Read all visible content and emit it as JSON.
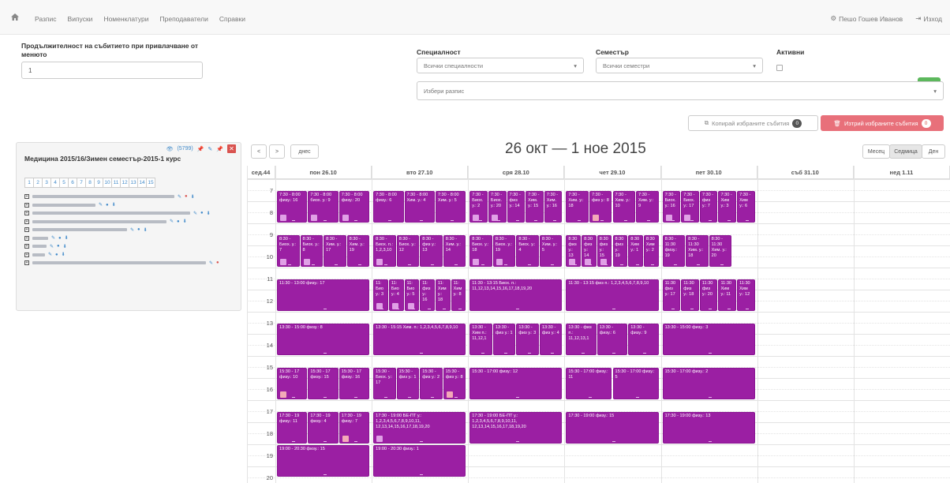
{
  "nav": {
    "items": [
      "Разпис",
      "Випуски",
      "Номенклатури",
      "Преподаватели",
      "Справки"
    ],
    "user": "Пешо Гошев Иванов",
    "logout": "Изход"
  },
  "form": {
    "duration_label": "Продължителност на събитието при привлачване от менюто",
    "duration_value": "1",
    "specialty_label": "Специалност",
    "specialty_value": "Всички специалности",
    "semester_label": "Семестър",
    "semester_value": "Всички семестри",
    "active_label": "Активни",
    "schedule_placeholder": "Избери разпис"
  },
  "actions": {
    "copy_label": "Копирай избраните събития",
    "copy_count": "0",
    "delete_label": "Изтрий избраните събития",
    "delete_count": "0"
  },
  "panel": {
    "title": "Медицина 2015/16/Зимен семестър-2015-1 курс",
    "count_link": "(5799)",
    "pages": [
      "1",
      "2",
      "3",
      "4",
      "5",
      "6",
      "7",
      "8",
      "9",
      "10",
      "11",
      "12",
      "13",
      "14",
      "15"
    ],
    "rows": [
      {
        "w": 180,
        "icons": [
          "pencil",
          "minus-red",
          "pin"
        ]
      },
      {
        "w": 80,
        "icons": [
          "pencil",
          "eye",
          "pin"
        ]
      },
      {
        "w": 200,
        "icons": [
          "pencil",
          "eye",
          "pin"
        ]
      },
      {
        "w": 170,
        "icons": [
          "pencil",
          "eye",
          "pin"
        ]
      },
      {
        "w": 120,
        "icons": [
          "pencil",
          "eye",
          "pin"
        ]
      },
      {
        "w": 20,
        "icons": [
          "pencil",
          "eye",
          "pin"
        ]
      },
      {
        "w": 18,
        "icons": [
          "pencil",
          "eye",
          "pin"
        ]
      },
      {
        "w": 16,
        "icons": [
          "pencil",
          "eye",
          "pin"
        ]
      },
      {
        "w": 220,
        "icons": [
          "pencil",
          "minus-red"
        ]
      }
    ]
  },
  "calendar": {
    "prev": "<",
    "next": ">",
    "today": "днес",
    "title": "26 окт — 1 ное 2015",
    "views": [
      "Месец",
      "Седмица",
      "Ден"
    ],
    "active_view": "Седмица",
    "week_label": "сед.44",
    "days": [
      "пон 26.10",
      "вто 27.10",
      "сря 28.10",
      "чет 29.10",
      "пет 30.10",
      "съб 31.10",
      "нед 1.11"
    ],
    "hours": [
      "7",
      "8",
      "9",
      "10",
      "11",
      "12",
      "13",
      "14",
      "15",
      "16",
      "17",
      "18",
      "19",
      "20"
    ],
    "events": [
      {
        "day": 0,
        "start": 7.5,
        "end": 9,
        "col": 0,
        "cols": 3,
        "text": "7:30 - 8:00 физу.: 16",
        "icon": "magnifier"
      },
      {
        "day": 0,
        "start": 7.5,
        "end": 9,
        "col": 1,
        "cols": 3,
        "text": "7:30 - 8:00 биох. у.: 9",
        "icon": "magnifier"
      },
      {
        "day": 0,
        "start": 7.5,
        "end": 9,
        "col": 2,
        "cols": 3,
        "text": "7:30 - 8:00 физу.: 20",
        "icon": "magnifier"
      },
      {
        "day": 1,
        "start": 7.5,
        "end": 9,
        "col": 0,
        "cols": 3,
        "text": "7:30 - 8:00 физу.: 6",
        "icon": ""
      },
      {
        "day": 1,
        "start": 7.5,
        "end": 9,
        "col": 1,
        "cols": 3,
        "text": "7:30 - 8:00 Хим. у.: 4",
        "icon": ""
      },
      {
        "day": 1,
        "start": 7.5,
        "end": 9,
        "col": 2,
        "cols": 3,
        "text": "7:30 - 8:00 Хим. у.: 5",
        "icon": ""
      },
      {
        "day": 2,
        "start": 7.5,
        "end": 9,
        "col": 0,
        "cols": 5,
        "text": "7:30 - Биох. у.: 2",
        "icon": "magnifier"
      },
      {
        "day": 2,
        "start": 7.5,
        "end": 9,
        "col": 1,
        "cols": 5,
        "text": "7:30 - Биох. у.: 20",
        "icon": "magnifier"
      },
      {
        "day": 2,
        "start": 7.5,
        "end": 9,
        "col": 2,
        "cols": 5,
        "text": "7:30 - физ у.: 14",
        "icon": ""
      },
      {
        "day": 2,
        "start": 7.5,
        "end": 9,
        "col": 3,
        "cols": 5,
        "text": "7:30 - Хим. у.: 15",
        "icon": ""
      },
      {
        "day": 2,
        "start": 7.5,
        "end": 9,
        "col": 4,
        "cols": 5,
        "text": "7:30 - Хим. у.: 16",
        "icon": ""
      },
      {
        "day": 3,
        "start": 7.5,
        "end": 9,
        "col": 0,
        "cols": 4,
        "text": "7:30 - Хим. у.: 18",
        "icon": ""
      },
      {
        "day": 3,
        "start": 7.5,
        "end": 9,
        "col": 1,
        "cols": 4,
        "text": "7:30 - физ у.: 8",
        "icon": "red"
      },
      {
        "day": 3,
        "start": 7.5,
        "end": 9,
        "col": 2,
        "cols": 4,
        "text": "7:30 - Хим. у.: 10",
        "icon": ""
      },
      {
        "day": 3,
        "start": 7.5,
        "end": 9,
        "col": 3,
        "cols": 4,
        "text": "7:30 - Хим. у.: 9",
        "icon": ""
      },
      {
        "day": 4,
        "start": 7.5,
        "end": 9,
        "col": 0,
        "cols": 5,
        "text": "7:30 - Биох. у.: 16",
        "icon": "magnifier"
      },
      {
        "day": 4,
        "start": 7.5,
        "end": 9,
        "col": 1,
        "cols": 5,
        "text": "7:30 - Биох. у.: 17",
        "icon": "magnifier"
      },
      {
        "day": 4,
        "start": 7.5,
        "end": 9,
        "col": 2,
        "cols": 5,
        "text": "7:30 - физ у.: 7",
        "icon": ""
      },
      {
        "day": 4,
        "start": 7.5,
        "end": 9,
        "col": 3,
        "cols": 5,
        "text": "7:30 - Хим у.: 3",
        "icon": ""
      },
      {
        "day": 4,
        "start": 7.5,
        "end": 9,
        "col": 4,
        "cols": 5,
        "text": "7:30 - Хим у.: 6",
        "icon": ""
      },
      {
        "day": 0,
        "start": 9.5,
        "end": 11,
        "col": 0,
        "cols": 4,
        "text": "8:30 - Биох. у.: 7",
        "icon": "magnifier"
      },
      {
        "day": 0,
        "start": 9.5,
        "end": 11,
        "col": 1,
        "cols": 4,
        "text": "8:30 - Биох. у.: 8",
        "icon": "magnifier"
      },
      {
        "day": 0,
        "start": 9.5,
        "end": 11,
        "col": 2,
        "cols": 4,
        "text": "8:30 - Хим. у.: 17",
        "icon": ""
      },
      {
        "day": 0,
        "start": 9.5,
        "end": 11,
        "col": 3,
        "cols": 4,
        "text": "8:30 - Хим. у.: 19",
        "icon": ""
      },
      {
        "day": 1,
        "start": 9.5,
        "end": 11,
        "col": 0,
        "cols": 4,
        "text": "8:30 - Биох. п.: 1,2,3,10",
        "icon": "magnifier"
      },
      {
        "day": 1,
        "start": 9.5,
        "end": 11,
        "col": 1,
        "cols": 4,
        "text": "8:30 - Биох. у.: 12",
        "icon": ""
      },
      {
        "day": 1,
        "start": 9.5,
        "end": 11,
        "col": 2,
        "cols": 4,
        "text": "8:30 - физ у.: 13",
        "icon": ""
      },
      {
        "day": 1,
        "start": 9.5,
        "end": 11,
        "col": 3,
        "cols": 4,
        "text": "8:30 - Хим. у.: 14",
        "icon": ""
      },
      {
        "day": 2,
        "start": 9.5,
        "end": 11,
        "col": 0,
        "cols": 4,
        "text": "8:30 - Биох. у.: 18",
        "icon": "magnifier"
      },
      {
        "day": 2,
        "start": 9.5,
        "end": 11,
        "col": 1,
        "cols": 4,
        "text": "8:30 - Биох. у.: 19",
        "icon": "magnifier"
      },
      {
        "day": 2,
        "start": 9.5,
        "end": 11,
        "col": 2,
        "cols": 4,
        "text": "8:30 - Биох. у.: 4",
        "icon": ""
      },
      {
        "day": 2,
        "start": 9.5,
        "end": 11,
        "col": 3,
        "cols": 4,
        "text": "8:30 - Хим. у.: 5",
        "icon": ""
      },
      {
        "day": 3,
        "start": 9.5,
        "end": 11,
        "col": 0,
        "cols": 6,
        "text": "8:30 физ у.: 13",
        "icon": "magnifier"
      },
      {
        "day": 3,
        "start": 9.5,
        "end": 11,
        "col": 1,
        "cols": 6,
        "text": "8:30 физ у.: 14",
        "icon": "magnifier"
      },
      {
        "day": 3,
        "start": 9.5,
        "end": 11,
        "col": 2,
        "cols": 6,
        "text": "8:30 физ у.: 15",
        "icon": "magnifier"
      },
      {
        "day": 3,
        "start": 9.5,
        "end": 11,
        "col": 3,
        "cols": 6,
        "text": "8:30 физ у.: 19",
        "icon": ""
      },
      {
        "day": 3,
        "start": 9.5,
        "end": 11,
        "col": 4,
        "cols": 6,
        "text": "8:30 Хим у.: 1",
        "icon": ""
      },
      {
        "day": 3,
        "start": 9.5,
        "end": 11,
        "col": 5,
        "cols": 6,
        "text": "8:30 Хим у.: 2",
        "icon": ""
      },
      {
        "day": 4,
        "start": 9.5,
        "end": 11,
        "col": 0,
        "cols": 4,
        "text": "8:30 - 11:30 физу.: 19",
        "icon": ""
      },
      {
        "day": 4,
        "start": 9.5,
        "end": 11,
        "col": 1,
        "cols": 4,
        "text": "8:30 - 11:30 Хим. у.: 18",
        "icon": ""
      },
      {
        "day": 4,
        "start": 9.5,
        "end": 11,
        "col": 2,
        "cols": 4,
        "text": "8:30 - 11:30 Хим. у.: 20",
        "icon": ""
      },
      {
        "day": 0,
        "start": 11.5,
        "end": 13,
        "col": 0,
        "cols": 1,
        "text": "11:30 - 13:00 физу.: 17",
        "icon": ""
      },
      {
        "day": 1,
        "start": 11.5,
        "end": 13,
        "col": 0,
        "cols": 6,
        "text": "11: Био у.: 3",
        "icon": "magnifier"
      },
      {
        "day": 1,
        "start": 11.5,
        "end": 13,
        "col": 1,
        "cols": 6,
        "text": "11: Био у.: 4",
        "icon": "magnifier"
      },
      {
        "day": 1,
        "start": 11.5,
        "end": 13,
        "col": 2,
        "cols": 6,
        "text": "11: Био у.: 5",
        "icon": "magnifier"
      },
      {
        "day": 1,
        "start": 11.5,
        "end": 13,
        "col": 3,
        "cols": 6,
        "text": "11: физ у.: 16",
        "icon": ""
      },
      {
        "day": 1,
        "start": 11.5,
        "end": 13,
        "col": 4,
        "cols": 6,
        "text": "11: Хим у.: 18",
        "icon": ""
      },
      {
        "day": 1,
        "start": 11.5,
        "end": 13,
        "col": 5,
        "cols": 6,
        "text": "11: Хим у.: 8",
        "icon": ""
      },
      {
        "day": 2,
        "start": 11.5,
        "end": 13,
        "col": 0,
        "cols": 1,
        "text": "11:30 - 13:15 Биох. п.: 11,12,13,14,15,16,17,18,19,20",
        "icon": ""
      },
      {
        "day": 3,
        "start": 11.5,
        "end": 13,
        "col": 0,
        "cols": 1,
        "text": "11:30 - 13:15 физ п.: 1,2,3,4,5,6,7,8,9,10",
        "icon": ""
      },
      {
        "day": 4,
        "start": 11.5,
        "end": 13,
        "col": 0,
        "cols": 5,
        "text": "11:30 физ у.: 17",
        "icon": ""
      },
      {
        "day": 4,
        "start": 11.5,
        "end": 13,
        "col": 1,
        "cols": 5,
        "text": "11:30 физ у.: 18",
        "icon": ""
      },
      {
        "day": 4,
        "start": 11.5,
        "end": 13,
        "col": 2,
        "cols": 5,
        "text": "11:30 физ у.: 20",
        "icon": ""
      },
      {
        "day": 4,
        "start": 11.5,
        "end": 13,
        "col": 3,
        "cols": 5,
        "text": "11:30 Хим у.: 11",
        "icon": ""
      },
      {
        "day": 4,
        "start": 11.5,
        "end": 13,
        "col": 4,
        "cols": 5,
        "text": "11:30 Хим у.: 12",
        "icon": ""
      },
      {
        "day": 0,
        "start": 13.5,
        "end": 15,
        "col": 0,
        "cols": 1,
        "text": "13:30 - 15:00 физу.: 8",
        "icon": ""
      },
      {
        "day": 1,
        "start": 13.5,
        "end": 15,
        "col": 0,
        "cols": 1,
        "text": "13:30 - 15:15 Хим. п.: 1,2,3,4,5,6,7,8,9,10",
        "icon": ""
      },
      {
        "day": 2,
        "start": 13.5,
        "end": 15,
        "col": 0,
        "cols": 4,
        "text": "13:30 - Хим п.: 11,12,1",
        "icon": ""
      },
      {
        "day": 2,
        "start": 13.5,
        "end": 15,
        "col": 1,
        "cols": 4,
        "text": "13:30 - физ у.: 1",
        "icon": ""
      },
      {
        "day": 2,
        "start": 13.5,
        "end": 15,
        "col": 2,
        "cols": 4,
        "text": "13:30 - физ у.: 3",
        "icon": ""
      },
      {
        "day": 2,
        "start": 13.5,
        "end": 15,
        "col": 3,
        "cols": 4,
        "text": "13:30 - физ у.: 4",
        "icon": ""
      },
      {
        "day": 3,
        "start": 13.5,
        "end": 15,
        "col": 0,
        "cols": 3,
        "text": "13:30 - физ п.: 11,12,13,1",
        "icon": ""
      },
      {
        "day": 3,
        "start": 13.5,
        "end": 15,
        "col": 1,
        "cols": 3,
        "text": "13:30 - физу.: 6",
        "icon": ""
      },
      {
        "day": 3,
        "start": 13.5,
        "end": 15,
        "col": 2,
        "cols": 3,
        "text": "13:30 - физу.: 9",
        "icon": ""
      },
      {
        "day": 4,
        "start": 13.5,
        "end": 15,
        "col": 0,
        "cols": 1,
        "text": "13:30 - 15:00 физу.: 3",
        "icon": ""
      },
      {
        "day": 0,
        "start": 15.5,
        "end": 17,
        "col": 0,
        "cols": 3,
        "text": "15:30 - 17 физу.: 10",
        "icon": "red"
      },
      {
        "day": 0,
        "start": 15.5,
        "end": 17,
        "col": 1,
        "cols": 3,
        "text": "15:30 - 17 физу.: 15",
        "icon": ""
      },
      {
        "day": 0,
        "start": 15.5,
        "end": 17,
        "col": 2,
        "cols": 3,
        "text": "15:30 - 17 физу.: 16",
        "icon": ""
      },
      {
        "day": 1,
        "start": 15.5,
        "end": 17,
        "col": 0,
        "cols": 4,
        "text": "15:30 - Биох. у.: 17",
        "icon": ""
      },
      {
        "day": 1,
        "start": 15.5,
        "end": 17,
        "col": 1,
        "cols": 4,
        "text": "15:30 - физ у.: 1",
        "icon": ""
      },
      {
        "day": 1,
        "start": 15.5,
        "end": 17,
        "col": 2,
        "cols": 4,
        "text": "15:30 - физ у.: 2",
        "icon": ""
      },
      {
        "day": 1,
        "start": 15.5,
        "end": 17,
        "col": 3,
        "cols": 4,
        "text": "15:30 - физ у.: 8",
        "icon": "red"
      },
      {
        "day": 2,
        "start": 15.5,
        "end": 17,
        "col": 0,
        "cols": 1,
        "text": "15:30 - 17:00 физу.: 12",
        "icon": ""
      },
      {
        "day": 3,
        "start": 15.5,
        "end": 17,
        "col": 0,
        "cols": 2,
        "text": "15:30 - 17:00 физу.: 11",
        "icon": ""
      },
      {
        "day": 3,
        "start": 15.5,
        "end": 17,
        "col": 1,
        "cols": 2,
        "text": "15:30 - 17:00 физу.: 5",
        "icon": ""
      },
      {
        "day": 4,
        "start": 15.5,
        "end": 17,
        "col": 0,
        "cols": 1,
        "text": "15:30 - 17:00 физу.: 2",
        "icon": ""
      },
      {
        "day": 0,
        "start": 17.5,
        "end": 19,
        "col": 0,
        "cols": 3,
        "text": "17:30 - 19 физу.: 11",
        "icon": ""
      },
      {
        "day": 0,
        "start": 17.5,
        "end": 19,
        "col": 1,
        "cols": 3,
        "text": "17:30 - 19 физу.: 4",
        "icon": ""
      },
      {
        "day": 0,
        "start": 17.5,
        "end": 19,
        "col": 2,
        "cols": 3,
        "text": "17:30 - 19 физу.: 7",
        "icon": "red"
      },
      {
        "day": 1,
        "start": 17.5,
        "end": 19,
        "col": 0,
        "cols": 1,
        "text": "17:30 - 19:00 БЕ-ПТ у.: 1,2,3,4,5,6,7,8,9,10,11, 12,13,14,15,16,17,18,19,20",
        "icon": "magnifier"
      },
      {
        "day": 2,
        "start": 17.5,
        "end": 19,
        "col": 0,
        "cols": 1,
        "text": "17:30 - 19:00 БЕ-ПТ у.: 1,2,3,4,5,6,7,8,9,10,11, 12,13,14,15,16,17,18,19,20",
        "icon": ""
      },
      {
        "day": 3,
        "start": 17.5,
        "end": 19,
        "col": 0,
        "cols": 1,
        "text": "17:30 - 19:00 физу.: 15",
        "icon": ""
      },
      {
        "day": 4,
        "start": 17.5,
        "end": 19,
        "col": 0,
        "cols": 1,
        "text": "17:30 - 19:00 физу.: 13",
        "icon": ""
      },
      {
        "day": 0,
        "start": 19,
        "end": 20.5,
        "col": 0,
        "cols": 1,
        "text": "19:00 - 20:30 физу.: 15",
        "icon": ""
      },
      {
        "day": 1,
        "start": 19,
        "end": 20.5,
        "col": 0,
        "cols": 1,
        "text": "19:00 - 20:30 физу.: 1",
        "icon": ""
      }
    ]
  },
  "colors": {
    "event": "#9b1fa3",
    "success": "#5cb85c",
    "danger": "#e8707a",
    "link": "#428bca"
  }
}
